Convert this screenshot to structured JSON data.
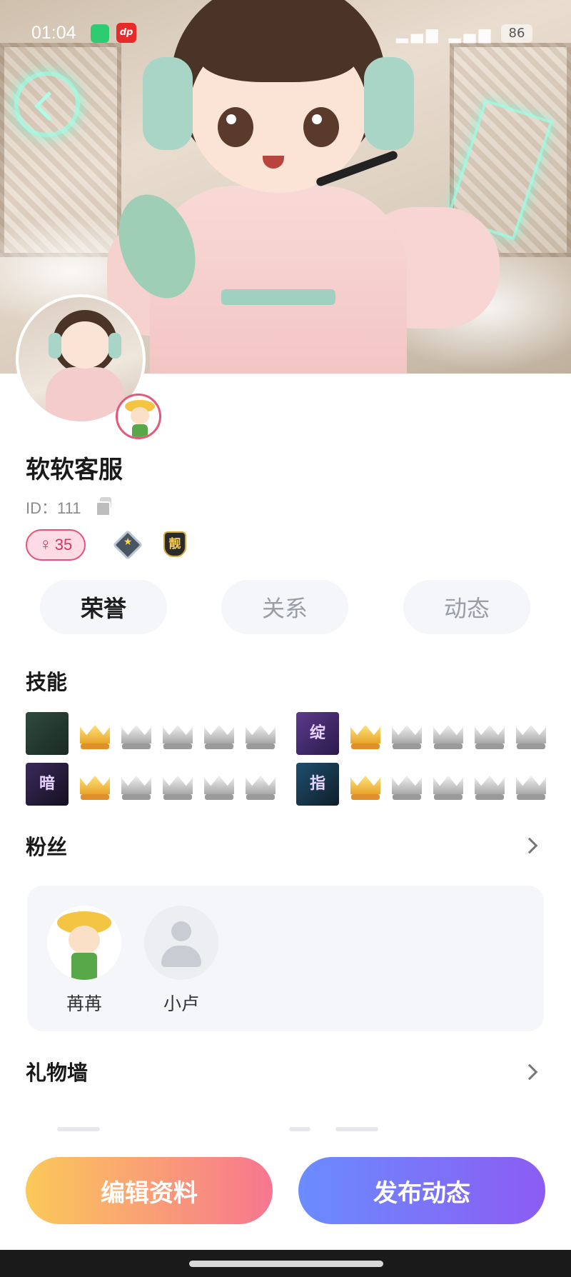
{
  "status_bar": {
    "time": "01:04",
    "app2": "dp",
    "battery": "86"
  },
  "profile": {
    "name": "软软客服",
    "id_label": "ID：111",
    "level": "35"
  },
  "tabs": [
    {
      "label": "荣誉"
    },
    {
      "label": "关系"
    },
    {
      "label": "动态"
    }
  ],
  "skills": {
    "title": "技能",
    "items": [
      {
        "icon": "sword-icon",
        "glyph": "",
        "gold": 1,
        "silver": 4
      },
      {
        "icon": "lotus-icon",
        "glyph": "绽",
        "gold": 1,
        "silver": 4
      },
      {
        "icon": "purple-emblem-icon",
        "glyph": "暗",
        "gold": 1,
        "silver": 4
      },
      {
        "icon": "blue-emblem-icon",
        "glyph": "指",
        "gold": 1,
        "silver": 4
      }
    ]
  },
  "fans": {
    "title": "粉丝",
    "items": [
      {
        "name": "苒苒"
      },
      {
        "name": "小卢"
      }
    ]
  },
  "gift_wall": {
    "title": "礼物墙"
  },
  "buttons": {
    "edit": "编辑资料",
    "post": "发布动态"
  },
  "medals": {
    "medal2": "靓"
  },
  "colors": {
    "accent_pink": "#e5527a",
    "edit_gradient": [
      "#fbc95a",
      "#f7768f"
    ],
    "post_gradient": [
      "#6a8cff",
      "#8c5cf2"
    ]
  }
}
